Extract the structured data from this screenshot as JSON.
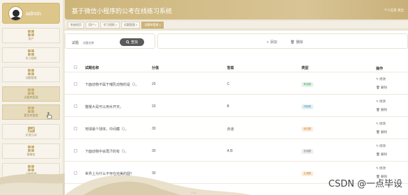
{
  "sidebar": {
    "user_name": "admin",
    "items": [
      {
        "label": "用户",
        "icon": "grid-icon"
      },
      {
        "label": "学习视频",
        "icon": "grid-icon"
      },
      {
        "label": "试题管理",
        "icon": "grid-icon"
      },
      {
        "label": "试题库管理",
        "icon": "grid-icon"
      },
      {
        "label": "题目库管理",
        "icon": "grid-icon"
      },
      {
        "label": "交流互动",
        "icon": "trend-icon"
      },
      {
        "label": "客服信",
        "icon": "grid-icon"
      },
      {
        "label": "试卷管理",
        "icon": "grid-icon"
      }
    ]
  },
  "header": {
    "title": "基于微信小程序的公考在线练习系统",
    "user_links": "个人信息  退出"
  },
  "crumbs": [
    "系统首页",
    "用户 ×",
    "学习视频 ×",
    "试题管理 ×",
    "试题库管理 ×"
  ],
  "search": {
    "label": "试题",
    "placeholder": "试题名称",
    "button_label": "查找"
  },
  "actions": {
    "add_label": "添加",
    "delete_label": "删除"
  },
  "table": {
    "headers": {
      "name": "试题名称",
      "score": "分值",
      "answer": "答案",
      "type": "类型",
      "ops": "操作"
    },
    "edit_label": "修改",
    "delete_label": "删除",
    "rows": [
      {
        "name": "下面动物不属于哺乳动物的是（）。",
        "score": "20",
        "answer": "C",
        "type": "单选题",
        "type_color": "#6ec48f"
      },
      {
        "name": "猫猴大是可以用水开天。",
        "score": "20",
        "answer": "B",
        "type": "判断题",
        "type_color": "#7cc0d8"
      },
      {
        "name": "地球最个球体，中间藏（）。",
        "score": "30",
        "answer": "赤道",
        "type": "填空题",
        "type_color": "#e0a56a"
      },
      {
        "name": "下面动物中会再汗的有（）。",
        "score": "30",
        "answer": "A,B",
        "type": "多选题",
        "type_color": "#9aa0a8"
      },
      {
        "name": "世界上为什么不存在完美的圆？",
        "score": "30",
        "answer": "",
        "type": "主观题",
        "type_color": "#e0a56a"
      }
    ]
  },
  "watermark": "CSDN @一点毕设",
  "colors": {
    "accent": "#cdb57a",
    "header": "#d3bd87"
  }
}
